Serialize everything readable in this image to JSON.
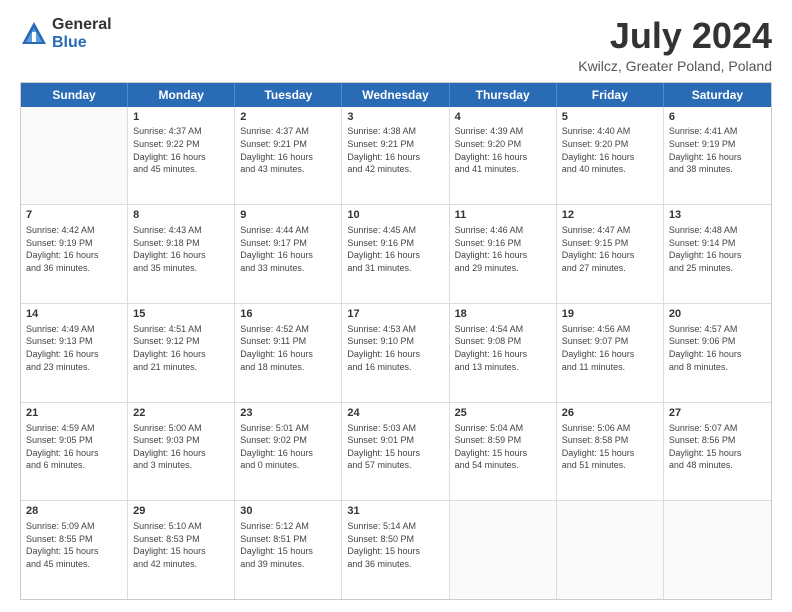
{
  "logo": {
    "general": "General",
    "blue": "Blue"
  },
  "header": {
    "title": "July 2024",
    "subtitle": "Kwilcz, Greater Poland, Poland"
  },
  "calendar": {
    "days": [
      "Sunday",
      "Monday",
      "Tuesday",
      "Wednesday",
      "Thursday",
      "Friday",
      "Saturday"
    ],
    "rows": [
      [
        {
          "day": "",
          "text": ""
        },
        {
          "day": "1",
          "text": "Sunrise: 4:37 AM\nSunset: 9:22 PM\nDaylight: 16 hours\nand 45 minutes."
        },
        {
          "day": "2",
          "text": "Sunrise: 4:37 AM\nSunset: 9:21 PM\nDaylight: 16 hours\nand 43 minutes."
        },
        {
          "day": "3",
          "text": "Sunrise: 4:38 AM\nSunset: 9:21 PM\nDaylight: 16 hours\nand 42 minutes."
        },
        {
          "day": "4",
          "text": "Sunrise: 4:39 AM\nSunset: 9:20 PM\nDaylight: 16 hours\nand 41 minutes."
        },
        {
          "day": "5",
          "text": "Sunrise: 4:40 AM\nSunset: 9:20 PM\nDaylight: 16 hours\nand 40 minutes."
        },
        {
          "day": "6",
          "text": "Sunrise: 4:41 AM\nSunset: 9:19 PM\nDaylight: 16 hours\nand 38 minutes."
        }
      ],
      [
        {
          "day": "7",
          "text": "Sunrise: 4:42 AM\nSunset: 9:19 PM\nDaylight: 16 hours\nand 36 minutes."
        },
        {
          "day": "8",
          "text": "Sunrise: 4:43 AM\nSunset: 9:18 PM\nDaylight: 16 hours\nand 35 minutes."
        },
        {
          "day": "9",
          "text": "Sunrise: 4:44 AM\nSunset: 9:17 PM\nDaylight: 16 hours\nand 33 minutes."
        },
        {
          "day": "10",
          "text": "Sunrise: 4:45 AM\nSunset: 9:16 PM\nDaylight: 16 hours\nand 31 minutes."
        },
        {
          "day": "11",
          "text": "Sunrise: 4:46 AM\nSunset: 9:16 PM\nDaylight: 16 hours\nand 29 minutes."
        },
        {
          "day": "12",
          "text": "Sunrise: 4:47 AM\nSunset: 9:15 PM\nDaylight: 16 hours\nand 27 minutes."
        },
        {
          "day": "13",
          "text": "Sunrise: 4:48 AM\nSunset: 9:14 PM\nDaylight: 16 hours\nand 25 minutes."
        }
      ],
      [
        {
          "day": "14",
          "text": "Sunrise: 4:49 AM\nSunset: 9:13 PM\nDaylight: 16 hours\nand 23 minutes."
        },
        {
          "day": "15",
          "text": "Sunrise: 4:51 AM\nSunset: 9:12 PM\nDaylight: 16 hours\nand 21 minutes."
        },
        {
          "day": "16",
          "text": "Sunrise: 4:52 AM\nSunset: 9:11 PM\nDaylight: 16 hours\nand 18 minutes."
        },
        {
          "day": "17",
          "text": "Sunrise: 4:53 AM\nSunset: 9:10 PM\nDaylight: 16 hours\nand 16 minutes."
        },
        {
          "day": "18",
          "text": "Sunrise: 4:54 AM\nSunset: 9:08 PM\nDaylight: 16 hours\nand 13 minutes."
        },
        {
          "day": "19",
          "text": "Sunrise: 4:56 AM\nSunset: 9:07 PM\nDaylight: 16 hours\nand 11 minutes."
        },
        {
          "day": "20",
          "text": "Sunrise: 4:57 AM\nSunset: 9:06 PM\nDaylight: 16 hours\nand 8 minutes."
        }
      ],
      [
        {
          "day": "21",
          "text": "Sunrise: 4:59 AM\nSunset: 9:05 PM\nDaylight: 16 hours\nand 6 minutes."
        },
        {
          "day": "22",
          "text": "Sunrise: 5:00 AM\nSunset: 9:03 PM\nDaylight: 16 hours\nand 3 minutes."
        },
        {
          "day": "23",
          "text": "Sunrise: 5:01 AM\nSunset: 9:02 PM\nDaylight: 16 hours\nand 0 minutes."
        },
        {
          "day": "24",
          "text": "Sunrise: 5:03 AM\nSunset: 9:01 PM\nDaylight: 15 hours\nand 57 minutes."
        },
        {
          "day": "25",
          "text": "Sunrise: 5:04 AM\nSunset: 8:59 PM\nDaylight: 15 hours\nand 54 minutes."
        },
        {
          "day": "26",
          "text": "Sunrise: 5:06 AM\nSunset: 8:58 PM\nDaylight: 15 hours\nand 51 minutes."
        },
        {
          "day": "27",
          "text": "Sunrise: 5:07 AM\nSunset: 8:56 PM\nDaylight: 15 hours\nand 48 minutes."
        }
      ],
      [
        {
          "day": "28",
          "text": "Sunrise: 5:09 AM\nSunset: 8:55 PM\nDaylight: 15 hours\nand 45 minutes."
        },
        {
          "day": "29",
          "text": "Sunrise: 5:10 AM\nSunset: 8:53 PM\nDaylight: 15 hours\nand 42 minutes."
        },
        {
          "day": "30",
          "text": "Sunrise: 5:12 AM\nSunset: 8:51 PM\nDaylight: 15 hours\nand 39 minutes."
        },
        {
          "day": "31",
          "text": "Sunrise: 5:14 AM\nSunset: 8:50 PM\nDaylight: 15 hours\nand 36 minutes."
        },
        {
          "day": "",
          "text": ""
        },
        {
          "day": "",
          "text": ""
        },
        {
          "day": "",
          "text": ""
        }
      ]
    ]
  }
}
